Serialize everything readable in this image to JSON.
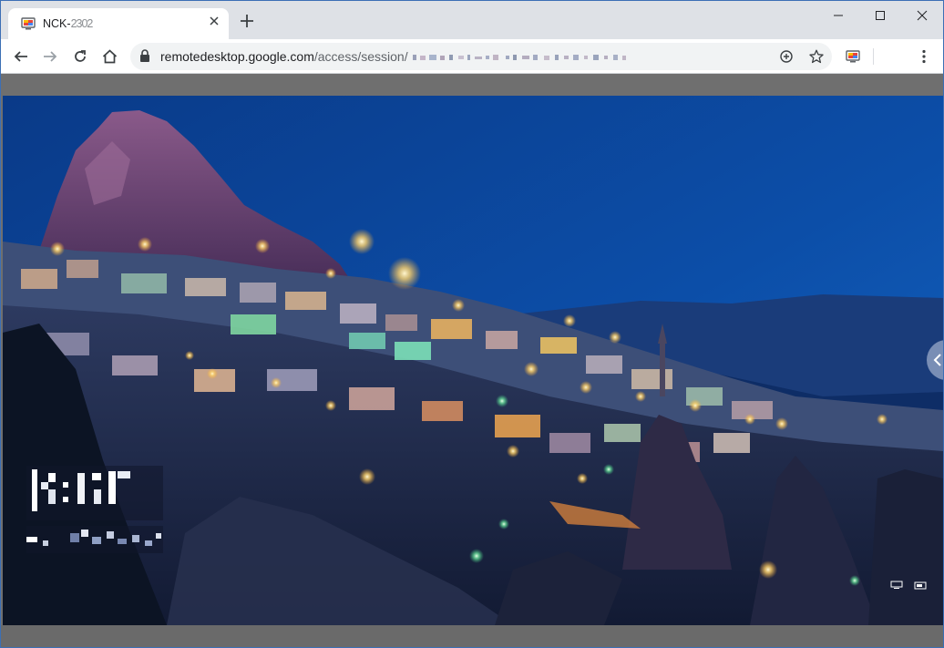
{
  "browser": {
    "tab_title": "NCK-",
    "tab_title_masked": "2302",
    "url_host": "remotedesktop.google.com",
    "url_path": "/access/session/"
  },
  "colors": {
    "tabstrip": "#dee1e6",
    "toolbar": "#ffffff",
    "omnibox": "#f1f3f4",
    "sky_top": "#0b3f8f",
    "sky_bottom": "#0f58b8",
    "content_bg": "#6f6f6f"
  },
  "icons": {
    "favicon": "chrome-remote-desktop-icon",
    "back": "arrow-left-icon",
    "forward": "arrow-right-icon",
    "reload": "reload-icon",
    "home": "home-icon",
    "lock": "lock-icon",
    "zoom": "zoom-icon",
    "bookmark": "star-icon",
    "extension": "remote-desktop-extension-icon",
    "menu": "kebab-menu-icon"
  },
  "remote": {
    "lock_screen_clock": "",
    "lock_screen_date": ""
  }
}
